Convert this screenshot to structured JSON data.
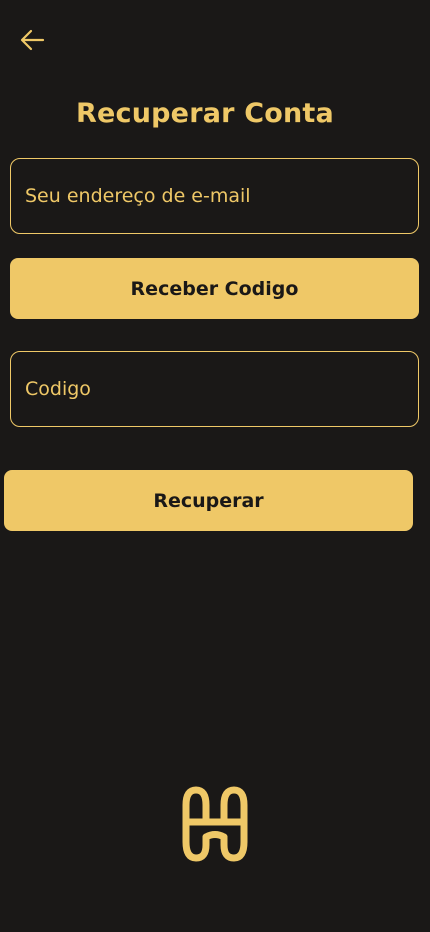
{
  "header": {
    "back_icon": "arrow-left-icon",
    "title": "Recuperar Conta"
  },
  "form": {
    "email_placeholder": "Seu endereço de e-mail",
    "email_value": "",
    "send_code_label": "Receber Codigo",
    "code_placeholder": "Codigo",
    "code_value": "",
    "recover_label": "Recuperar"
  },
  "brand": {
    "logo_icon": "brand-logo-icon"
  },
  "colors": {
    "background": "#1a1817",
    "accent": "#efc867",
    "button_text": "#1a1817"
  }
}
